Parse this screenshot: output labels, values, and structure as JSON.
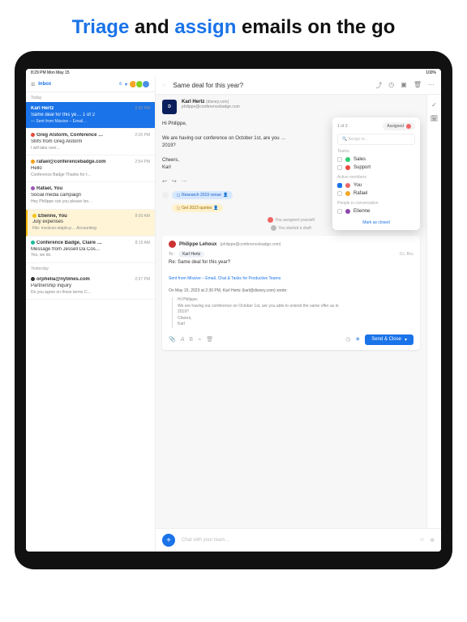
{
  "hero": {
    "pre": "Triage",
    "mid": " and ",
    "hl2": "assign",
    "post": " emails on the go"
  },
  "statusbar": {
    "left": "8:29 PM  Mon May 15",
    "right": "100%"
  },
  "sidebar": {
    "title": "Inbox",
    "count": "6",
    "sections": [
      "Today",
      "Yesterday"
    ],
    "items": [
      {
        "from": "Karl Hertz",
        "time": "2:30 PM",
        "subj": "Same deal for this ye…  1 of 2",
        "prev": "— Sent from Missive – Email…"
      },
      {
        "from": "Greg Alstorm, Conference …",
        "time": "2:26 PM",
        "subj": "SMS from Greg Alstorm",
        "prev": "I will take over…"
      },
      {
        "from": "rafael@conferencebadge.com",
        "time": "2:54 PM",
        "subj": "Hello",
        "prev": "Conference Badge Thanks for t…"
      },
      {
        "from": "Rafael, You",
        "time": "",
        "subj": "Social media campaign",
        "prev": "Hey Philippe can you please loo…"
      },
      {
        "from": "Etienne, You",
        "time": "8:00 AM",
        "subj": "July expenses",
        "prev": "File: invoices-staple.p…  Accounting"
      },
      {
        "from": "Conference Badge, Claire …",
        "time": "8:15 AM",
        "subj": "Message from Jessell Da Cos…",
        "prev": "Yes, we do."
      },
      {
        "from": "orphelia@nytimes.com",
        "time": "2:37 PM",
        "subj": "Partnership inquiry",
        "prev": "Do you agree on those terms C…"
      }
    ]
  },
  "toolbar": {
    "subject": "Same deal for this year?",
    "counter": "1 of 3"
  },
  "message": {
    "sender": "Karl Hertz",
    "org": "(disney.com)",
    "email": "philippe@conferencebadge.com",
    "greeting": "Hi Philippe,",
    "line": "We are having our conference on October 1st, are you …",
    "year": "2019?",
    "signoff": "Cheers,",
    "name": "Karl"
  },
  "chips": {
    "a": "Research 2019 venue",
    "b": "Get 2023 quotes"
  },
  "activity": {
    "a": "You assigned yourself",
    "b": "You started a draft"
  },
  "compose": {
    "author": "Philippe Lehoux",
    "authorEmail": "(philippe@conferencebadge.com)",
    "toLabel": "To :",
    "toPill": "Karl Hertz",
    "ccbcc": "Cc, Bcc",
    "subject": "Re: Same deal for this year?",
    "sent": "Sent from Missive – Email, Chat & Tasks for Productive Teams",
    "quoteIntro": "On May 15, 2023 at 2:30 PM, Karl Hertz (karl@disney.com) wrote:",
    "q1": "Hi Philippe,",
    "q2": "We are having our conference on October 1st, are you able to extend the same offer as in",
    "q3": "2019?",
    "q4": "Cheers,",
    "q5": "Karl",
    "send": "Send & Close"
  },
  "chat": {
    "placeholder": "Chat with your team…"
  },
  "popover": {
    "counter": "1 of 3",
    "assigned": "Assigned",
    "search": "Assign to…",
    "teamsLabel": "Teams",
    "teams": [
      {
        "name": "Sales",
        "color": "#2ecc71"
      },
      {
        "name": "Support",
        "color": "#e74c3c"
      }
    ],
    "activeLabel": "Active members",
    "members": [
      {
        "name": "You",
        "on": true
      },
      {
        "name": "Rafael",
        "on": false
      }
    ],
    "peopleLabel": "People in conversation",
    "people": [
      {
        "name": "Etienne"
      }
    ],
    "close": "Mark as closed"
  }
}
